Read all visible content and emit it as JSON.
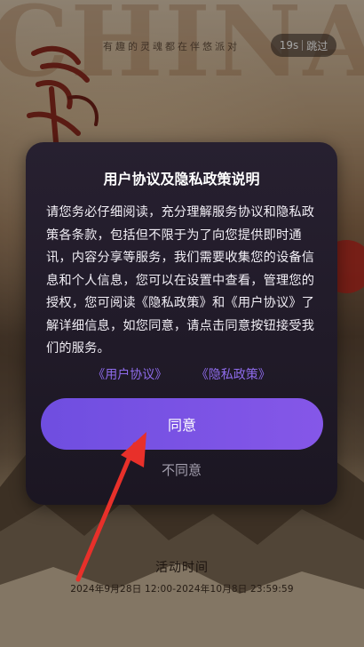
{
  "background": {
    "big_text": "CHINA",
    "tagline": "有趣的灵魂都在伴悠派对",
    "skip": {
      "countdown": "19s",
      "label": "跳过"
    }
  },
  "dialog": {
    "title": "用户协议及隐私政策说明",
    "body": "请您务必仔细阅读，充分理解服务协议和隐私政策各条款，包括但不限于为了向您提供即时通讯，内容分享等服务，我们需要收集您的设备信息和个人信息，您可以在设置中查看，管理您的授权，您可阅读《隐私政策》和《用户协议》了解详细信息，如您同意，请点击同意按钮接受我们的服务。",
    "links": {
      "user_agreement": "《用户协议》",
      "privacy_policy": "《隐私政策》"
    },
    "agree_label": "同意",
    "disagree_label": "不同意"
  },
  "activity": {
    "title": "活动时间",
    "range": "2024年9月28日 12:00-2024年10月8日 23:59:59"
  },
  "colors": {
    "accent": "#7a55e6",
    "link": "#8e6bea",
    "arrow": "#e8302a"
  }
}
